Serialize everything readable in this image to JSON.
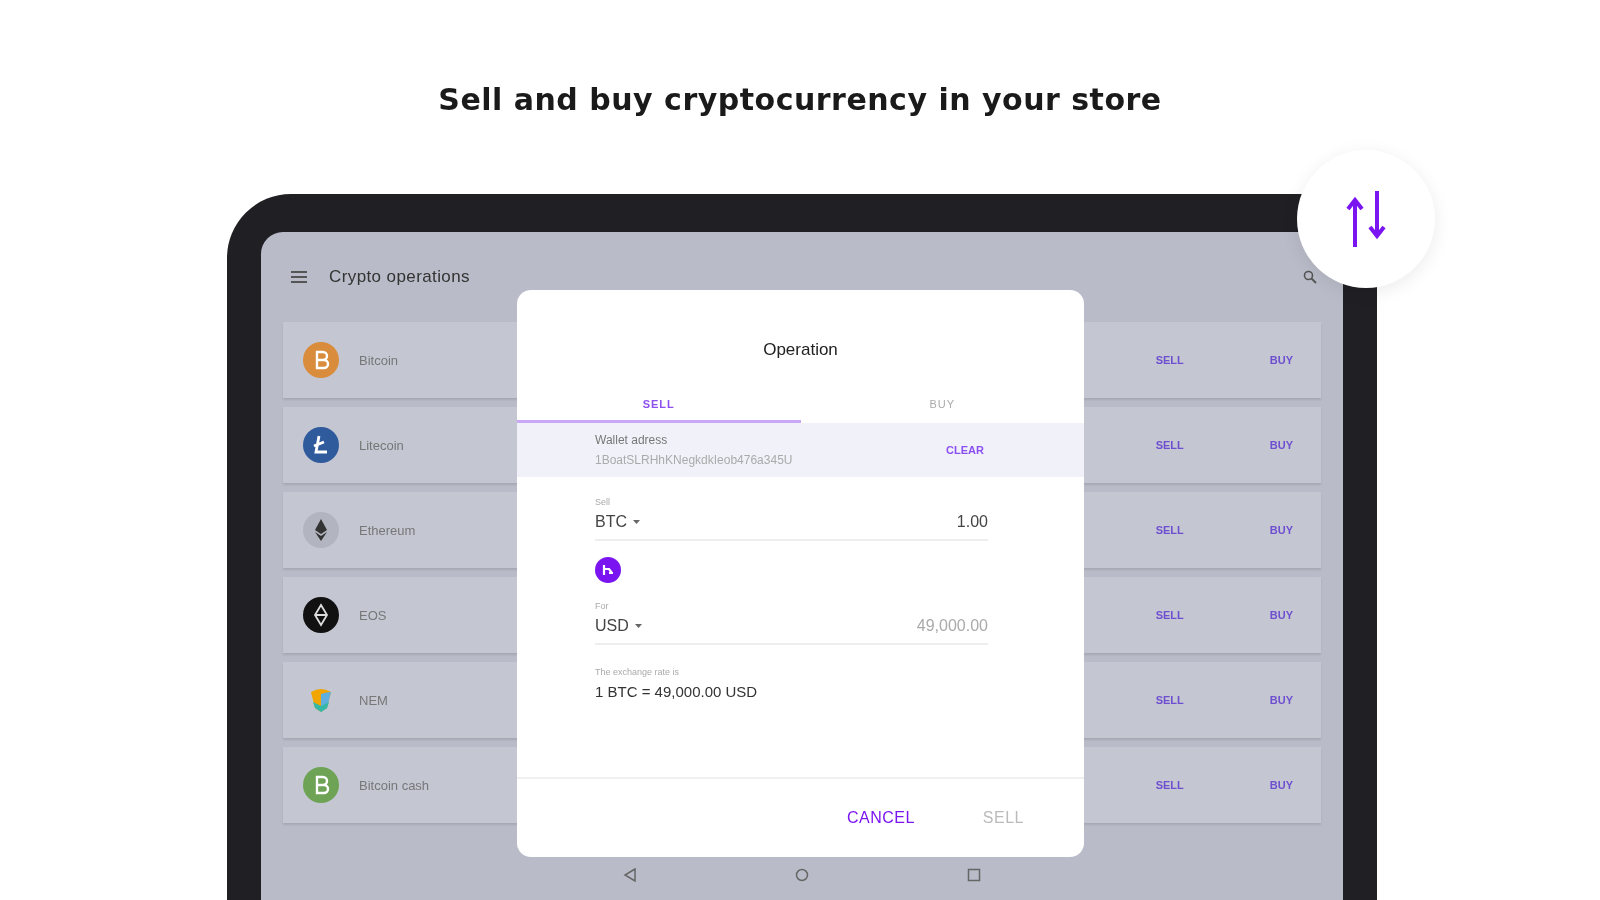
{
  "headline": "Sell and buy cryptocurrency in your store",
  "app_bar": {
    "title": "Crypto operations"
  },
  "coins": [
    {
      "kind": "bitcoin",
      "name": "Bitcoin",
      "sell": "SELL",
      "buy": "BUY"
    },
    {
      "kind": "litecoin",
      "name": "Litecoin",
      "sell": "SELL",
      "buy": "BUY"
    },
    {
      "kind": "ethereum",
      "name": "Ethereum",
      "sell": "SELL",
      "buy": "BUY"
    },
    {
      "kind": "eos",
      "name": "EOS",
      "sell": "SELL",
      "buy": "BUY"
    },
    {
      "kind": "nem",
      "name": "NEM",
      "sell": "SELL",
      "buy": "BUY"
    },
    {
      "kind": "bitcoincash",
      "name": "Bitcoin cash",
      "sell": "SELL",
      "buy": "BUY"
    }
  ],
  "dialog": {
    "title": "Operation",
    "tabs": [
      {
        "label": "SELL",
        "selected": true
      },
      {
        "label": "BUY",
        "selected": false
      }
    ],
    "wallet": {
      "label": "Wallet adress",
      "value": "1BoatSLRHhKNegkdkIeob476a345U",
      "clear": "CLEAR"
    },
    "sell_field": {
      "label": "Sell",
      "currency": "BTC",
      "amount": "1.00"
    },
    "for_field": {
      "label": "For",
      "currency": "USD",
      "amount": "49,000.00"
    },
    "rate": {
      "label": "The exchange rate is",
      "value": "1 BTC = 49,000.00 USD"
    },
    "buttons": [
      {
        "label": "CANCEL",
        "disabled": false
      },
      {
        "label": "SELL",
        "disabled": true
      }
    ]
  }
}
